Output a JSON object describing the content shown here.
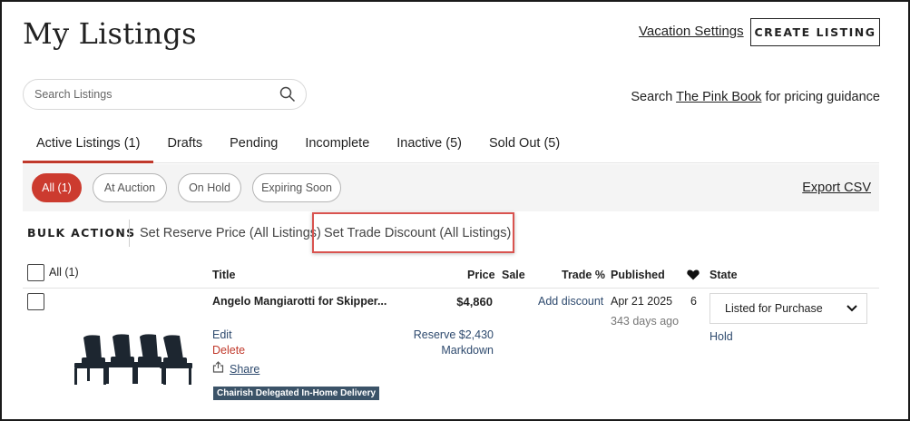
{
  "header": {
    "title": "My Listings",
    "vacation_link": "Vacation Settings",
    "create_button": "CREATE LISTING"
  },
  "search": {
    "placeholder": "Search Listings",
    "value": "",
    "pinkbook_prefix": "Search ",
    "pinkbook_link": "The Pink Book",
    "pinkbook_suffix": " for pricing guidance"
  },
  "tabs": [
    {
      "label": "Active Listings (1)",
      "active": true
    },
    {
      "label": "Drafts",
      "active": false
    },
    {
      "label": "Pending",
      "active": false
    },
    {
      "label": "Incomplete",
      "active": false
    },
    {
      "label": "Inactive (5)",
      "active": false
    },
    {
      "label": "Sold Out (5)",
      "active": false
    }
  ],
  "filters": [
    {
      "label": "All (1)",
      "active": true
    },
    {
      "label": "At Auction",
      "active": false
    },
    {
      "label": "On Hold",
      "active": false
    },
    {
      "label": "Expiring Soon",
      "active": false
    }
  ],
  "export_label": "Export CSV",
  "bulk": {
    "label": "BULK ACTIONS",
    "reserve_action": "Set Reserve Price (All Listings)",
    "trade_action": "Set Trade Discount (All Listings)"
  },
  "table": {
    "select_all_label": "All (1)",
    "columns": {
      "title": "Title",
      "price": "Price",
      "sale": "Sale",
      "trade": "Trade %",
      "published": "Published",
      "favorites_icon": "heart-icon",
      "state": "State"
    },
    "rows": [
      {
        "title": "Angelo Mangiarotti for Skipper...",
        "price": "$4,860",
        "trade_action": "Add discount",
        "published_date": "Apr 21 2025",
        "published_ago": "343 days ago",
        "favorites": "6",
        "state": "Listed for Purchase",
        "hold": "Hold",
        "edit": "Edit",
        "delete": "Delete",
        "share": "Share",
        "reserve": "Reserve $2,430",
        "markdown": "Markdown",
        "badge": "Chairish Delegated In-Home Delivery"
      }
    ]
  },
  "colors": {
    "accent": "#cc3b2f",
    "link": "#2e4a6e",
    "badge_bg": "#3b5368",
    "filter_bg": "#f4f4f4",
    "highlight": "#d9534f"
  }
}
